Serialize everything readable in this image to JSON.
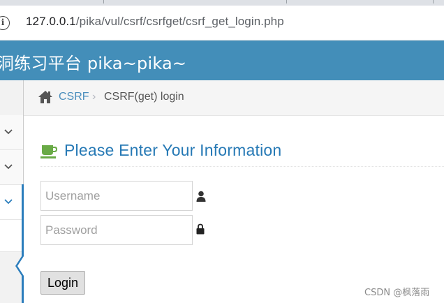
{
  "browser": {
    "url_host": "127.0.0.1",
    "url_path": "/pika/vul/csrf/csrfget/csrf_get_login.php"
  },
  "header": {
    "title": "洞练习平台 pika~pika~"
  },
  "breadcrumb": {
    "link": "CSRF",
    "separator": "›",
    "current": "CSRF(get) login"
  },
  "page": {
    "title": "Please Enter Your Information"
  },
  "form": {
    "username_placeholder": "Username",
    "username_value": "",
    "password_placeholder": "Password",
    "password_value": "",
    "login_label": "Login"
  },
  "sidebar": {
    "items": [
      {
        "icon": "chevron-down-icon",
        "active": false
      },
      {
        "icon": "chevron-down-icon",
        "active": false
      },
      {
        "icon": "chevron-down-icon",
        "active": true
      },
      {
        "icon": "none",
        "active": false
      }
    ]
  },
  "watermark": "CSDN @枫落雨",
  "colors": {
    "header": "#438eb9",
    "accent_blue": "#2b7dbc",
    "link": "#4c8fbd",
    "title": "#2679b5",
    "coffee_icon": "#69aa46"
  }
}
